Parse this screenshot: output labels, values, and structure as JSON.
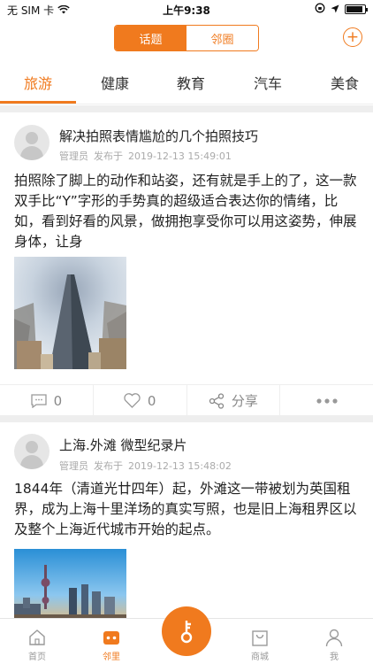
{
  "status_bar": {
    "carrier": "无 SIM 卡",
    "time": "上午9:38"
  },
  "header": {
    "segments": [
      "话题",
      "邻圈"
    ],
    "plus_icon": "plus-circle-icon"
  },
  "categories": [
    "旅游",
    "健康",
    "教育",
    "汽车",
    "美食"
  ],
  "posts": [
    {
      "title": "解决拍照表情尴尬的几个拍照技巧",
      "author": "管理员",
      "published_label": "发布于",
      "date": "2019-12-13 15:49:01",
      "body": "拍照除了脚上的动作和站姿，还有就是手上的了，这一款双手比“Y”字形的手势真的超级适合表达你的情绪，比如，看到好看的风景，做拥抱享受你可以用这姿势，伸展身体，让身",
      "comments": "0",
      "likes": "0",
      "share_label": "分享"
    },
    {
      "title": "上海.外滩 微型纪录片",
      "author": "管理员",
      "published_label": "发布于",
      "date": "2019-12-13 15:48:02",
      "body": "1844年（清道光廿四年）起，外滩这一带被划为英国租界，成为上海十里洋场的真实写照，也是旧上海租界区以及整个上海近代城市开始的起点。"
    }
  ],
  "tabbar": {
    "items": [
      "首页",
      "邻里",
      "商城",
      "我"
    ]
  },
  "colors": {
    "accent": "#f07a1e"
  }
}
